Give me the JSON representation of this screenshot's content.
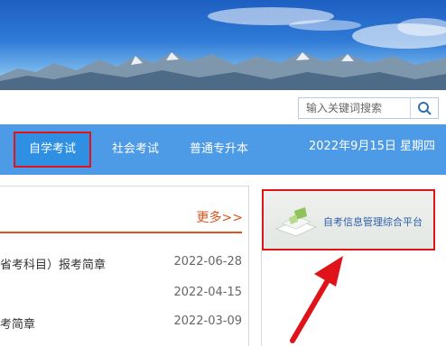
{
  "search": {
    "placeholder": "输入关键词搜索",
    "icon": "search-icon"
  },
  "nav": {
    "items": [
      "自学考试",
      "社会考试",
      "普通专升本"
    ],
    "active_index": 0,
    "date": "2022年9月15日 星期四"
  },
  "news": {
    "more_label": "更多>>",
    "items": [
      {
        "title": "省考科目）报考简章",
        "date": "2022-06-28"
      },
      {
        "title": "",
        "date": "2022-04-15"
      },
      {
        "title": "考简章",
        "date": "2022-03-09"
      }
    ]
  },
  "side": {
    "platform_label": "自考信息管理综合平台"
  },
  "colors": {
    "nav_bg": "#4d9ae6",
    "accent": "#e0531b",
    "highlight": "#e0131b"
  }
}
